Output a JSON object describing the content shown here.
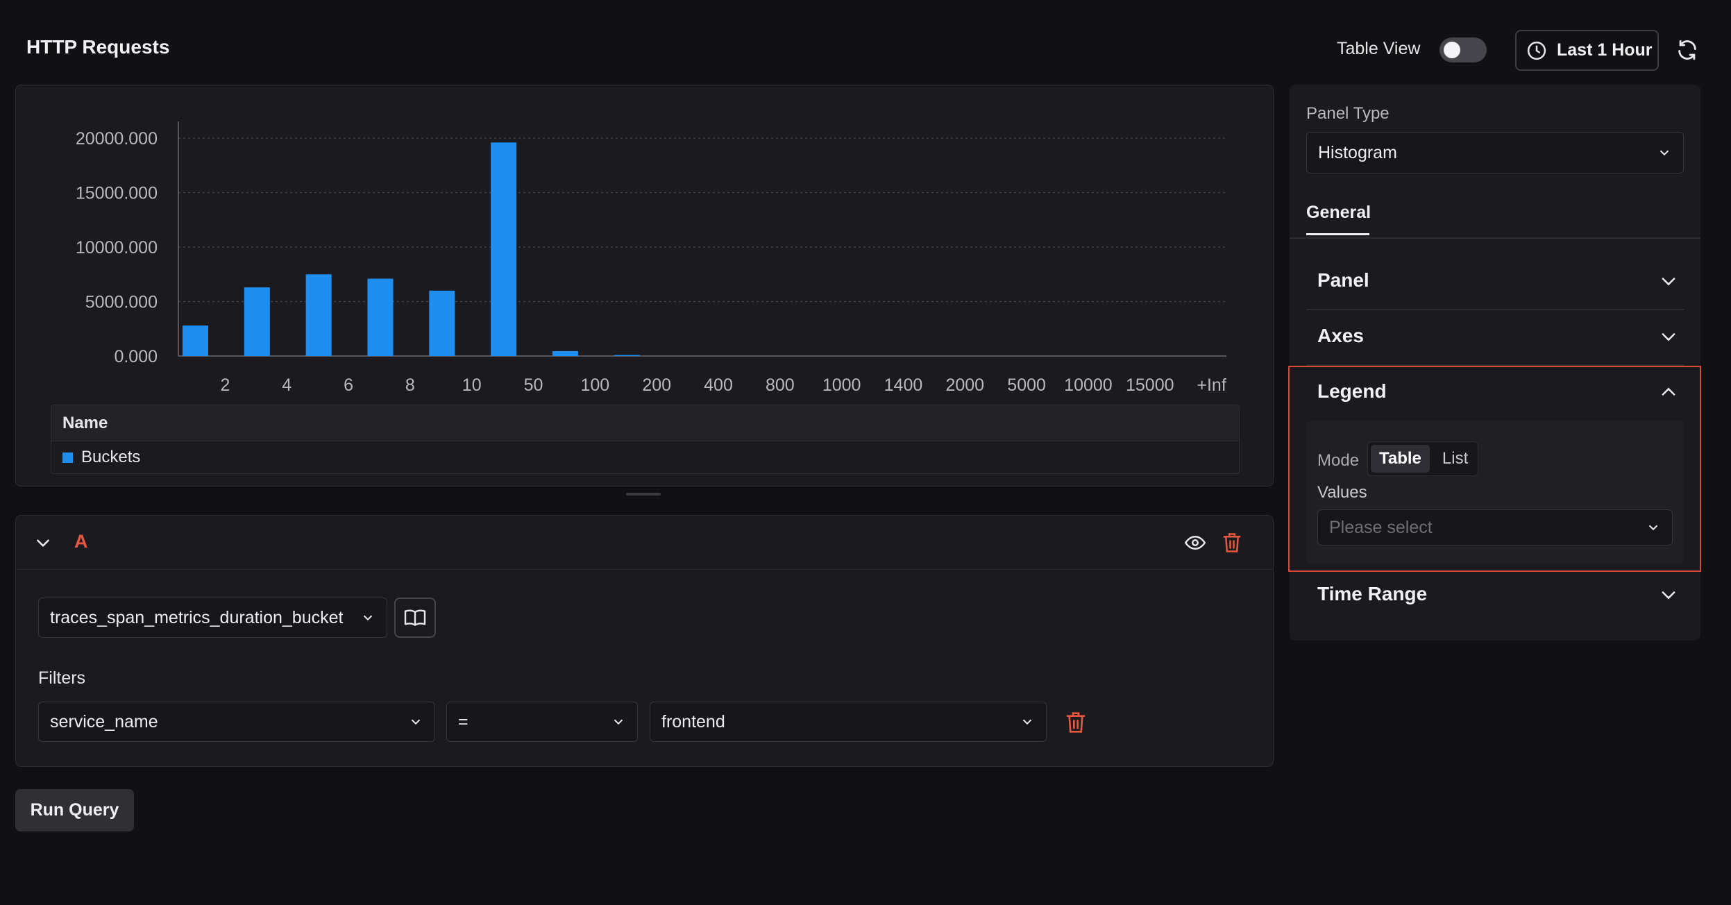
{
  "header": {
    "title": "HTTP Requests",
    "table_view_label": "Table View",
    "table_view_on": false,
    "time_range_label": "Last 1 Hour"
  },
  "chart_data": {
    "type": "bar",
    "categories": [
      "2",
      "4",
      "6",
      "8",
      "10",
      "50",
      "100",
      "200",
      "400",
      "800",
      "1000",
      "1400",
      "2000",
      "5000",
      "10000",
      "15000",
      "+Inf"
    ],
    "series": [
      {
        "name": "Buckets",
        "color": "#1f8ef1",
        "values": [
          2800,
          6300,
          7500,
          7100,
          6000,
          19600,
          450,
          60,
          0,
          0,
          0,
          0,
          0,
          0,
          0,
          0,
          0
        ]
      }
    ],
    "y_ticks": [
      "0.000",
      "5000.000",
      "10000.000",
      "15000.000",
      "20000.000"
    ],
    "ylim": [
      0,
      22000
    ],
    "grid": true,
    "legend": {
      "header": "Name",
      "position": "bottom"
    }
  },
  "query": {
    "label": "A",
    "metric": "traces_span_metrics_duration_bucket",
    "filters_label": "Filters",
    "filter": {
      "key": "service_name",
      "operator": "=",
      "value": "frontend"
    },
    "run_label": "Run Query"
  },
  "sidebar": {
    "panel_type_label": "Panel Type",
    "panel_type_value": "Histogram",
    "tab_general": "General",
    "sections": {
      "panel": "Panel",
      "axes": "Axes",
      "legend": "Legend",
      "time_range": "Time Range"
    },
    "legend": {
      "mode_label": "Mode",
      "mode_options": [
        "Table",
        "List"
      ],
      "mode_selected": "Table",
      "values_label": "Values",
      "values_placeholder": "Please select"
    }
  },
  "colors": {
    "accent": "#1f8ef1",
    "danger": "#e9573f",
    "highlight": "#d9463e"
  }
}
